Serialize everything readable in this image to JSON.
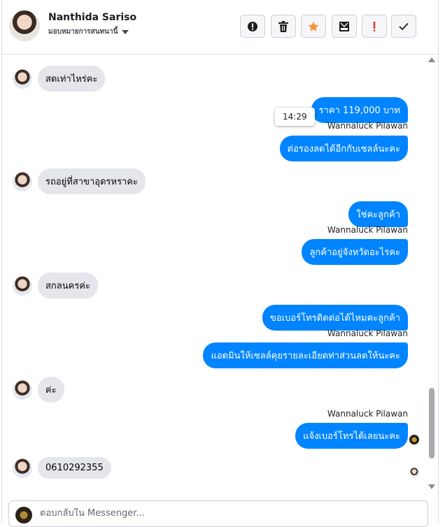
{
  "header": {
    "contact_name": "Nanthida Sariso",
    "assign_label": "มอบหมายการสนทนานี้",
    "toolbar": {
      "flag_icon": "exclamation-circle-icon",
      "delete_icon": "trash-icon",
      "star_icon": "star-icon",
      "archive_icon": "archive-icon",
      "spam_icon": "exclamation-icon",
      "done_icon": "checkmark-icon"
    }
  },
  "colors": {
    "outgoing_bubble": "#0084ff",
    "incoming_bubble": "#e4e6eb",
    "star": "#f7923a",
    "spam": "#e02f2f"
  },
  "messages": [
    {
      "side": "in",
      "text": "สดเท่าไหร่คะ"
    },
    {
      "side": "out",
      "text": "ราคา 119,000 บาท"
    },
    {
      "side": "out_sender",
      "text": "Wannaluck Pilawan"
    },
    {
      "side": "out",
      "text": "ต่อรองลดได้อีกกับเซลล์นะคะ"
    },
    {
      "side": "in",
      "text": "รถอยู่ที่สาขาอุดรหราคะ"
    },
    {
      "side": "out",
      "text": "ใช่คะลูกค้า"
    },
    {
      "side": "out_sender",
      "text": "Wannaluck Pilawan"
    },
    {
      "side": "out",
      "text": "ลูกค้าอยู่จังหวัดอะไรคะ"
    },
    {
      "side": "in",
      "text": "สกลนครค่ะ"
    },
    {
      "side": "out",
      "text": "ขอเบอร์โทรติดต่อได้ไหมคะลูกค้า"
    },
    {
      "side": "out_sender",
      "text": "Wannaluck Pilawan"
    },
    {
      "side": "out",
      "text": "แอดมินให้เซลล์คุยรายละเอียดท่าส่วนลดให้นะคะ"
    },
    {
      "side": "in",
      "text": "ค่ะ"
    },
    {
      "side": "out_sender",
      "text": "Wannaluck Pilawan"
    },
    {
      "side": "out",
      "text": "แจ้งเบอร์โทรได้เลยนะคะ"
    },
    {
      "side": "in",
      "text": "0610292355"
    }
  ],
  "tooltip_time": "14:29",
  "composer": {
    "placeholder": "ตอบกลับใน Messenger...",
    "value": ""
  }
}
